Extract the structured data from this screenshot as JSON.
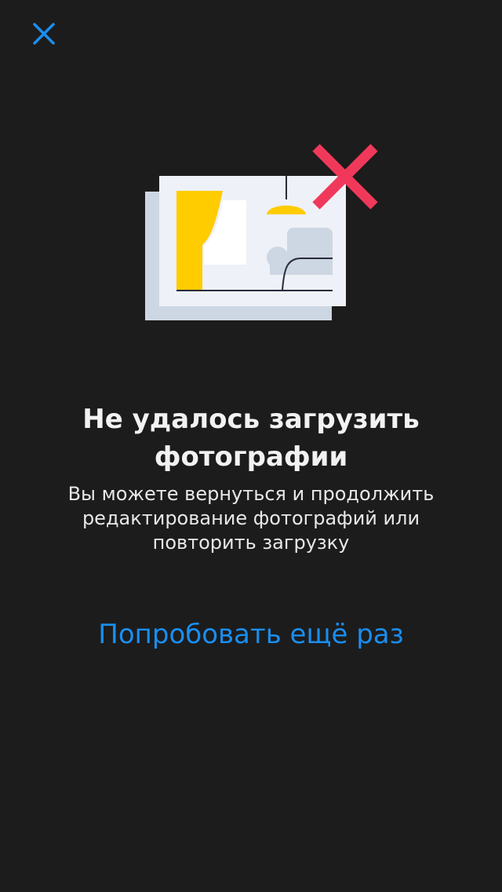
{
  "colors": {
    "background": "#1c1c1c",
    "accent": "#1a8ef0",
    "error_cross": "#f0395a",
    "photo_frame": "#eef1f7",
    "photo_back": "#cdd7e3",
    "curtain": "#ffcc00",
    "lamp": "#ffcc00",
    "sofa": "#cdd7e3",
    "line": "#2b2b3d"
  },
  "header": {
    "close_icon": "close-icon"
  },
  "illustration": {
    "icon": "photo-upload-failed-icon"
  },
  "error": {
    "title": "Не удалось загрузить фотографии",
    "description": "Вы можете вернуться и продолжить редактирование фотографий или повторить загрузку"
  },
  "actions": {
    "retry_label": "Попробовать ещё раз"
  }
}
